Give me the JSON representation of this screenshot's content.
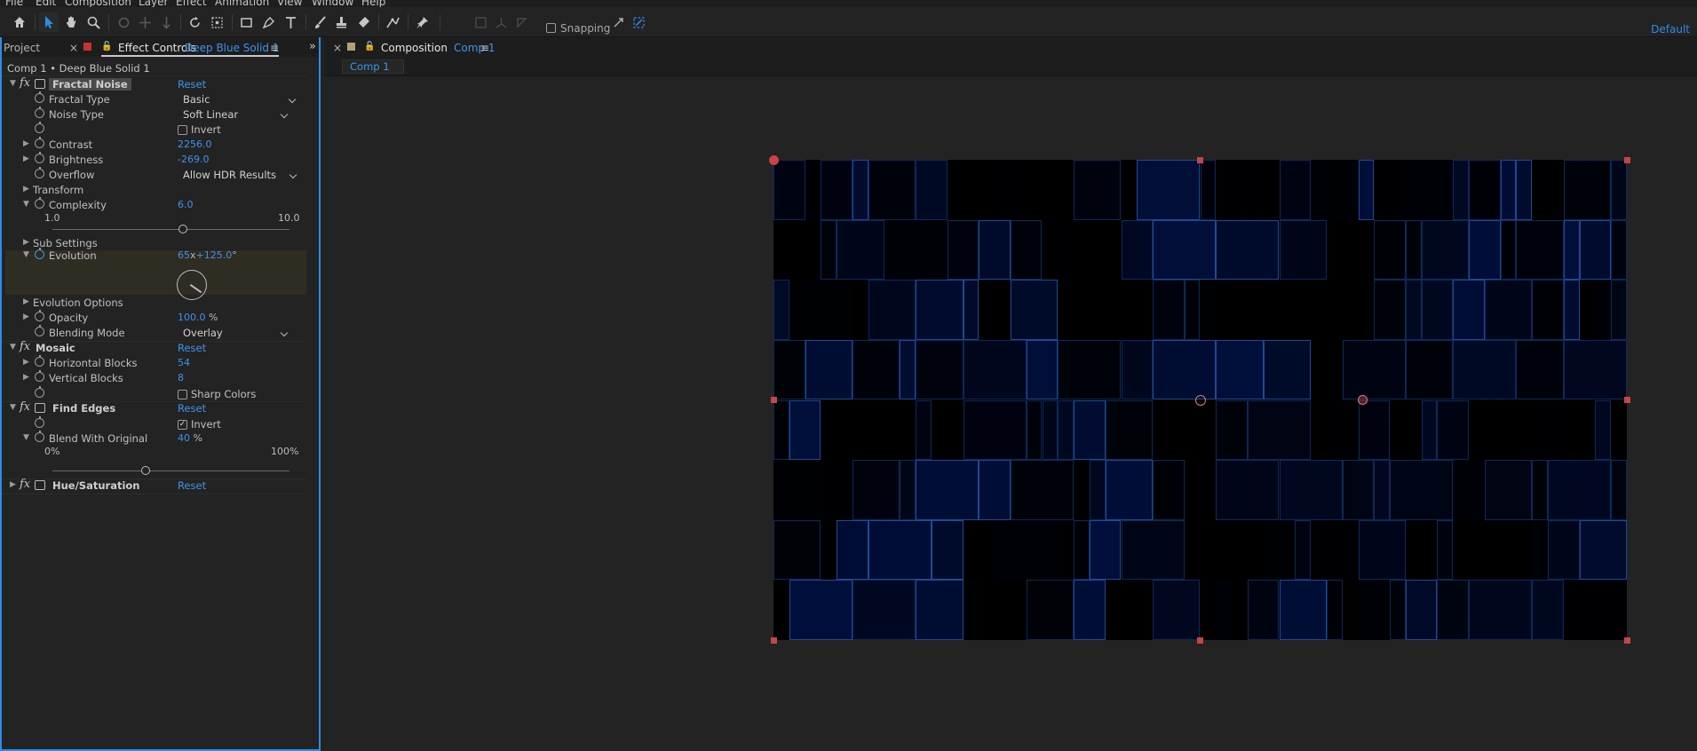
{
  "menu": [
    "File",
    "Edit",
    "Composition",
    "Layer",
    "Effect",
    "Animation",
    "View",
    "Window",
    "Help"
  ],
  "toolbar": {
    "snapping_label": "Snapping",
    "workspace": "Default",
    "icons": [
      "home-icon",
      "selection-tool-icon",
      "hand-tool-icon",
      "zoom-tool-icon",
      "orbit-camera-icon",
      "pan-camera-icon",
      "dolly-camera-icon",
      "rotate-tool-icon",
      "pan-behind-icon",
      "rectangle-tool-icon",
      "type-tool-icon",
      "brush-tool-icon",
      "clone-stamp-icon",
      "eraser-tool-icon",
      "roto-brush-icon",
      "puppet-pin-icon"
    ]
  },
  "left_panel": {
    "tab_project": "Project",
    "tab_effect_controls": "Effect Controls",
    "tab_layer_name": "Deep Blue Solid 1",
    "layer_title": "Comp 1 • Deep Blue Solid 1",
    "reset": "Reset",
    "fractal_noise": {
      "name": "Fractal Noise",
      "fractal_type_label": "Fractal Type",
      "fractal_type_value": "Basic",
      "noise_type_label": "Noise Type",
      "noise_type_value": "Soft Linear",
      "invert_label": "Invert",
      "contrast_label": "Contrast",
      "contrast_value": "2256.0",
      "brightness_label": "Brightness",
      "brightness_value": "-269.0",
      "overflow_label": "Overflow",
      "overflow_value": "Allow HDR Results",
      "transform_label": "Transform",
      "complexity_label": "Complexity",
      "complexity_value": "6.0",
      "complexity_min": "1.0",
      "complexity_max": "10.0",
      "sub_settings_label": "Sub Settings",
      "evolution_label": "Evolution",
      "evolution_rev": "65",
      "evolution_x": "x",
      "evolution_deg": "+125.0",
      "evolution_deg_unit": "°",
      "evolution_options_label": "Evolution Options",
      "opacity_label": "Opacity",
      "opacity_value": "100.0",
      "opacity_unit": "%",
      "blending_mode_label": "Blending Mode",
      "blending_mode_value": "Overlay"
    },
    "mosaic": {
      "name": "Mosaic",
      "horizontal_blocks_label": "Horizontal Blocks",
      "horizontal_blocks_value": "54",
      "vertical_blocks_label": "Vertical Blocks",
      "vertical_blocks_value": "8",
      "sharp_colors_label": "Sharp Colors"
    },
    "find_edges": {
      "name": "Find Edges",
      "invert_label": "Invert",
      "blend_label": "Blend With Original",
      "blend_value": "40",
      "blend_unit": "%",
      "blend_min": "0%",
      "blend_max": "100%"
    },
    "hue_saturation": {
      "name": "Hue/Saturation"
    }
  },
  "right_panel": {
    "tab_composition": "Composition",
    "tab_comp_name": "Comp 1",
    "flowchart_tab": "Comp 1"
  },
  "colors": {
    "accent": "#2d8ceb",
    "handle": "#c94444",
    "panel_bg": "#232323"
  }
}
